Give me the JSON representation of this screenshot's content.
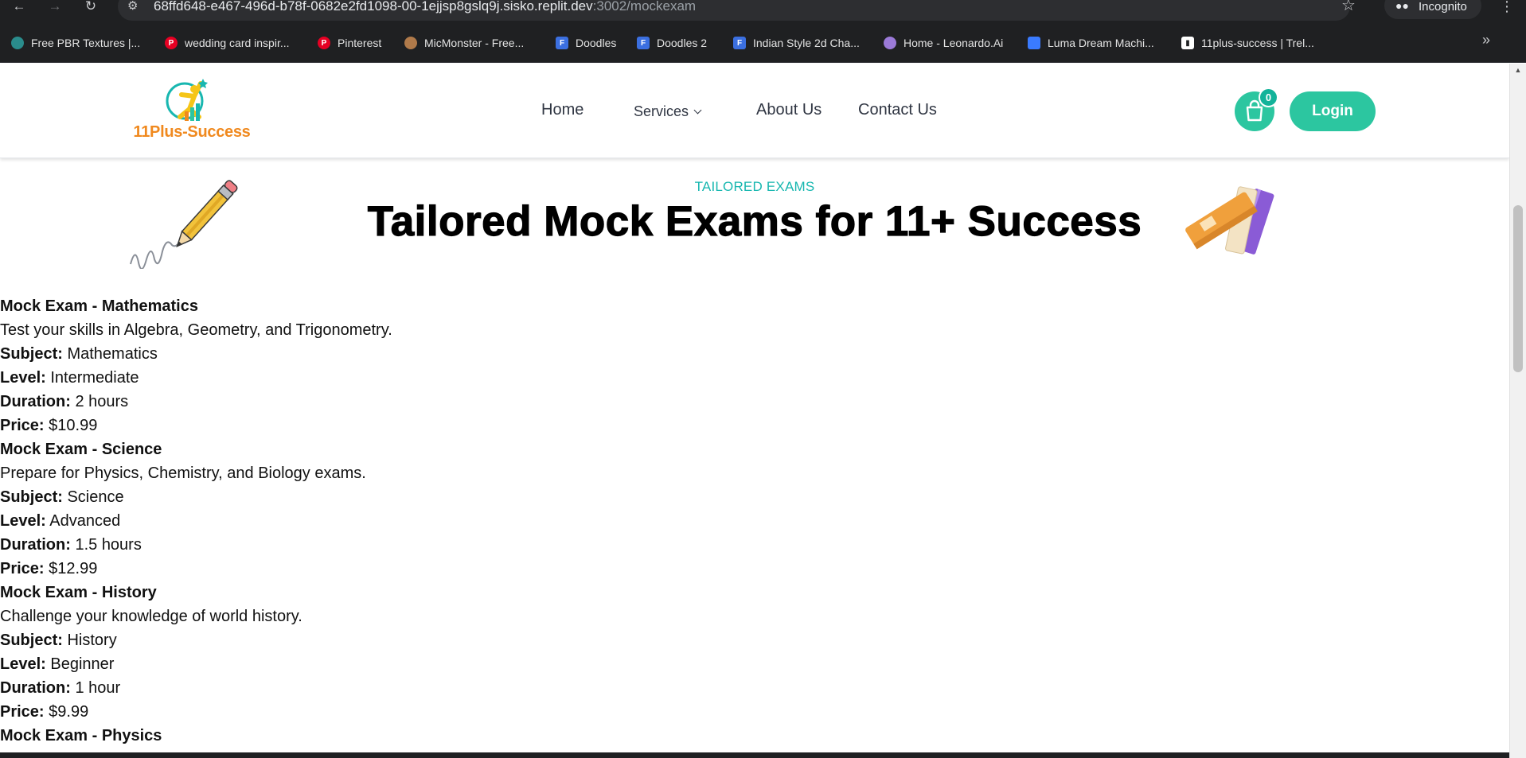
{
  "browser": {
    "url_host": "68ffd648-e467-496d-b78f-0682e2fd1098-00-1ejjsp8gslq9j.sisko.replit.dev",
    "url_path": ":3002/mockexam",
    "incognito_label": "Incognito",
    "bookmarks": [
      {
        "label": "Free PBR Textures |...",
        "icon": "globe-icon",
        "color": "#2a8c8c"
      },
      {
        "label": "wedding card inspir...",
        "icon": "pinterest-icon",
        "color": "#e60023"
      },
      {
        "label": "Pinterest",
        "icon": "pinterest-icon",
        "color": "#e60023"
      },
      {
        "label": "MicMonster - Free...",
        "icon": "mic-icon",
        "color": "#b07a4a"
      },
      {
        "label": "Doodles",
        "icon": "forms-icon",
        "color": "#3b6fe0"
      },
      {
        "label": "Doodles 2",
        "icon": "forms-icon",
        "color": "#3b6fe0"
      },
      {
        "label": "Indian Style 2d Cha...",
        "icon": "forms-icon",
        "color": "#3b6fe0"
      },
      {
        "label": "Home - Leonardo.Ai",
        "icon": "leonardo-icon",
        "color": "#9b7ad8"
      },
      {
        "label": "Luma Dream Machi...",
        "icon": "luma-icon",
        "color": "#3a7bff"
      },
      {
        "label": "11plus-success | Trel...",
        "icon": "trello-icon",
        "color": "#ffffff"
      }
    ]
  },
  "header": {
    "logo_text": "11Plus-Success",
    "nav": {
      "home": "Home",
      "services": "Services",
      "about": "About Us",
      "contact": "Contact Us"
    },
    "cart_count": "0",
    "login_label": "Login"
  },
  "hero": {
    "eyebrow": "TAILORED EXAMS",
    "title": "Tailored Mock Exams for 11+ Success"
  },
  "labels": {
    "subject": "Subject:",
    "level": "Level:",
    "duration": "Duration:",
    "price": "Price:"
  },
  "exams": [
    {
      "title": "Mock Exam - Mathematics",
      "description": "Test your skills in Algebra, Geometry, and Trigonometry.",
      "subject": "Mathematics",
      "level": "Intermediate",
      "duration": "2 hours",
      "price": "$10.99"
    },
    {
      "title": "Mock Exam - Science",
      "description": "Prepare for Physics, Chemistry, and Biology exams.",
      "subject": "Science",
      "level": "Advanced",
      "duration": "1.5 hours",
      "price": "$12.99"
    },
    {
      "title": "Mock Exam - History",
      "description": "Challenge your knowledge of world history.",
      "subject": "History",
      "level": "Beginner",
      "duration": "1 hour",
      "price": "$9.99"
    },
    {
      "title": "Mock Exam - Physics"
    }
  ],
  "colors": {
    "accent": "#2cc6a0",
    "eyebrow": "#18b7b0",
    "logo_orange": "#f0891e"
  }
}
